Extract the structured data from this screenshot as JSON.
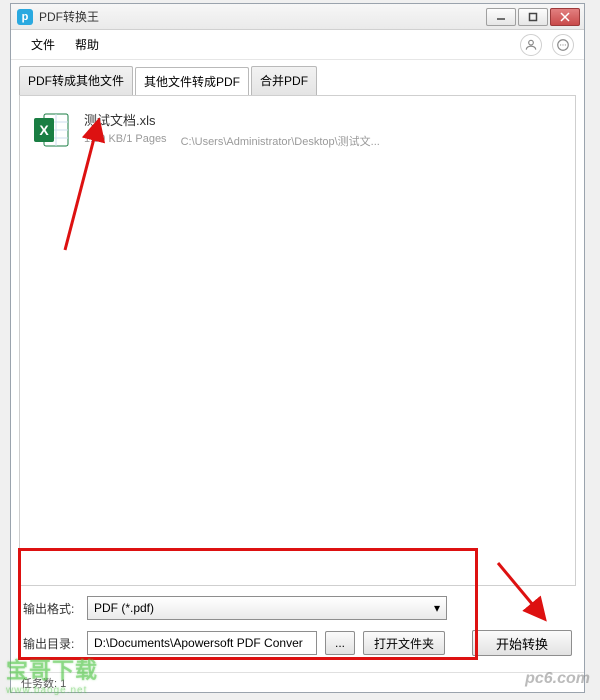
{
  "window": {
    "title": "PDF转换王"
  },
  "menubar": {
    "file": "文件",
    "help": "帮助"
  },
  "tabs": {
    "t1": "PDF转成其他文件",
    "t2": "其他文件转成PDF",
    "t3": "合并PDF"
  },
  "file": {
    "name": "测试文档.xls",
    "size": "1.69 KB/1 Pages",
    "path": "C:\\Users\\Administrator\\Desktop\\测试文..."
  },
  "form": {
    "format_label": "输出格式:",
    "format_value": "PDF (*.pdf)",
    "dir_label": "输出目录:",
    "dir_value": "D:\\Documents\\Apowersoft PDF Conver",
    "browse": "...",
    "open_folder": "打开文件夹",
    "start": "开始转换"
  },
  "status": {
    "tasks": "任务数: 1"
  },
  "watermarks": {
    "w1_main": "宝哥下载",
    "w1_sub": "www.baoge.net",
    "w2": "pc6.com"
  }
}
